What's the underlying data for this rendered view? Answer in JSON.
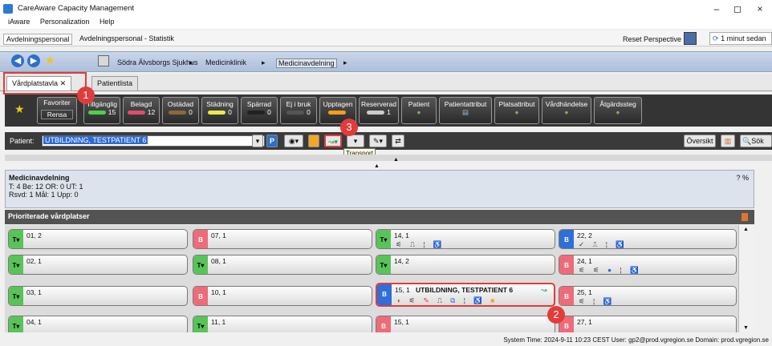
{
  "window": {
    "title": "CareAware Capacity Management",
    "minimize": "–",
    "maximize": "◻",
    "close": "×"
  },
  "menu": [
    "iAware",
    "Personalization",
    "Help"
  ],
  "perspectives": {
    "tabs": [
      "Avdelningspersonal",
      "Avdelningspersonal - Statistik"
    ],
    "reset": "Reset Perspective",
    "refresh": "1 minut sedan"
  },
  "breadcrumb": [
    "Södra Älvsborgs Sjukhus",
    "Medicinklinik",
    "Medicinavdelning"
  ],
  "tabs": [
    "Vårdplatstavla",
    "Patientlista"
  ],
  "filters": {
    "favoriter": "Favoriter",
    "rensa": "Rensa",
    "items": [
      {
        "label": "Tillgänglig",
        "count": "15",
        "color": "#4cd04c"
      },
      {
        "label": "Belagd",
        "count": "12",
        "color": "#e04d6c"
      },
      {
        "label": "Ostädad",
        "count": "0",
        "color": "#8a6a3a"
      },
      {
        "label": "Städning",
        "count": "0",
        "color": "#e9e94a"
      },
      {
        "label": "Spärrad",
        "count": "0",
        "color": "#222222"
      },
      {
        "label": "Ej i bruk",
        "count": "0",
        "color": "#555555"
      },
      {
        "label": "Upptagen",
        "count": "",
        "color": "#ff9a1e"
      },
      {
        "label": "Reserverad",
        "count": "1",
        "color": "#cccccc"
      },
      {
        "label": "Patient",
        "count": "",
        "color": "#7fb24a"
      },
      {
        "label": "Patientattribut",
        "count": "",
        "color": "#5b86c9"
      },
      {
        "label": "Platsattribut",
        "count": "",
        "color": "#7fb24a"
      },
      {
        "label": "Vårdhändelse",
        "count": "",
        "color": "#7fb24a"
      },
      {
        "label": "Åtgärdssteg",
        "count": "",
        "color": "#7fb24a"
      }
    ]
  },
  "patient": {
    "label": "Patient:",
    "value": "UTBILDNING, TESTPATIENT 6",
    "oversikt": "Översikt",
    "sok": "Sök",
    "tooltip": "Transport"
  },
  "unit": {
    "name": "Medicinavdelning",
    "line1": "T: 4 Be: 12 OR: 0 UT: 1",
    "line2": "Rsvd: 1 Mål: 1 Upp: 0",
    "pct": "? %"
  },
  "prio_label": "Prioriterade vårdplatser",
  "columns": [
    [
      {
        "bed": "01, 2",
        "state": "T",
        "color": "green"
      },
      {
        "bed": "02, 1",
        "state": "T",
        "color": "green"
      },
      {
        "bed": "03, 1",
        "state": "T",
        "color": "green"
      },
      {
        "bed": "04, 1",
        "state": "T",
        "color": "green"
      }
    ],
    [
      {
        "bed": "07, 1",
        "state": "B",
        "color": "pink"
      },
      {
        "bed": "08, 1",
        "state": "T",
        "color": "green"
      },
      {
        "bed": "10, 1",
        "state": "B",
        "color": "pink"
      },
      {
        "bed": "11, 1",
        "state": "T",
        "color": "green"
      }
    ],
    [
      {
        "bed": "14, 1",
        "state": "T",
        "color": "green"
      },
      {
        "bed": "14, 2",
        "state": "T",
        "color": "green"
      },
      {
        "bed": "15, 1",
        "state": "B",
        "color": "blue",
        "patient": "UTBILDNING, TESTPATIENT 6"
      },
      {
        "bed": "15, 1",
        "state": "B",
        "color": "pink"
      }
    ],
    [
      {
        "bed": "22, 2",
        "state": "B",
        "color": "blue"
      },
      {
        "bed": "24, 1",
        "state": "B",
        "color": "pink"
      },
      {
        "bed": "25, 1",
        "state": "B",
        "color": "pink"
      },
      {
        "bed": "27, 1",
        "state": "B",
        "color": "pink"
      }
    ]
  ],
  "callouts": [
    "1",
    "2",
    "3"
  ],
  "statusbar": "System Time: 2024-9-11 10:23 CEST User: gp2@prod.vgregion.se Domain: prod.vgregion.se"
}
